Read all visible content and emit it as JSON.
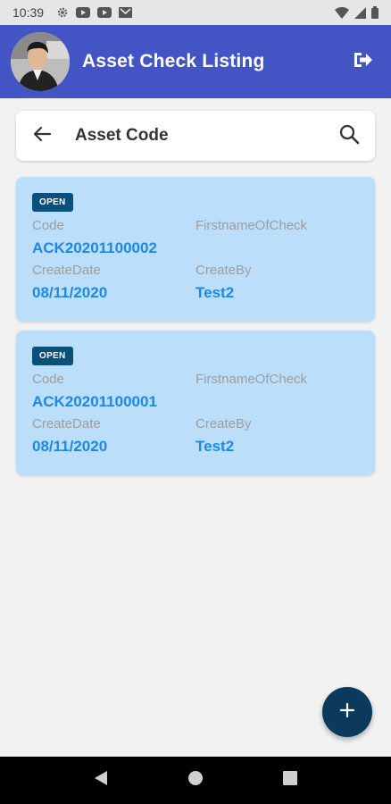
{
  "status_bar": {
    "time": "10:39",
    "icons": [
      "settings-icon",
      "youtube-icon",
      "youtube-icon",
      "gmail-icon",
      "wifi-icon",
      "signal-icon",
      "battery-icon"
    ]
  },
  "app_bar": {
    "title": "Asset Check Listing",
    "background": "#4355c4",
    "avatar_icon": "user-photo",
    "logout_icon": "logout-icon"
  },
  "search_bar": {
    "label": "Asset Code",
    "back_icon": "arrow-left-icon",
    "search_icon": "search-icon"
  },
  "cards": [
    {
      "status": "OPEN",
      "labels": {
        "code": "Code",
        "firstname": "FirstnameOfCheck",
        "create_date": "CreateDate",
        "create_by": "CreateBy"
      },
      "code": "ACK20201100002",
      "firstname": "",
      "create_date": "08/11/2020",
      "create_by": "Test2"
    },
    {
      "status": "OPEN",
      "labels": {
        "code": "Code",
        "firstname": "FirstnameOfCheck",
        "create_date": "CreateDate",
        "create_by": "CreateBy"
      },
      "code": "ACK20201100001",
      "firstname": "",
      "create_date": "08/11/2020",
      "create_by": "Test2"
    }
  ],
  "colors": {
    "card_background": "#bbdefb",
    "value_text": "#1e88e5",
    "badge": "#0b4f7d",
    "fab": "#0b3a5c"
  },
  "fab": {
    "icon": "plus-icon"
  },
  "nav_bar": {
    "icons": [
      "back-triangle-icon",
      "home-circle-icon",
      "recents-square-icon"
    ]
  }
}
